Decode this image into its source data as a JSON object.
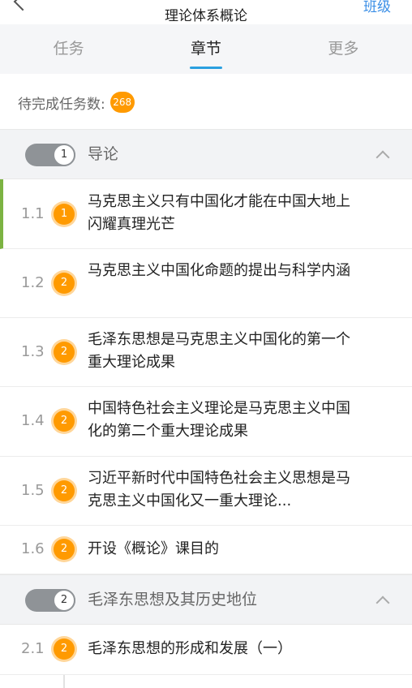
{
  "header": {
    "title": "理论体系概论",
    "right_link": "班级"
  },
  "tabs": [
    {
      "label": "任务"
    },
    {
      "label": "章节"
    },
    {
      "label": "更多"
    }
  ],
  "pending": {
    "label": "待完成任务数:",
    "count": "268"
  },
  "chapters": [
    {
      "number": "1",
      "title": "导论",
      "sections": [
        {
          "number": "1.1",
          "badge": "1",
          "title": "马克思主义只有中国化才能在中国大地上闪耀真理光芒"
        },
        {
          "number": "1.2",
          "badge": "2",
          "title": "马克思主义中国化命题的提出与科学内涵"
        },
        {
          "number": "1.3",
          "badge": "2",
          "title": "毛泽东思想是马克思主义中国化的第一个重大理论成果"
        },
        {
          "number": "1.4",
          "badge": "2",
          "title": "中国特色社会主义理论是马克思主义中国化的第二个重大理论成果"
        },
        {
          "number": "1.5",
          "badge": "2",
          "title": "习近平新时代中国特色社会主义思想是马克思主义中国化又一重大理论..."
        },
        {
          "number": "1.6",
          "badge": "2",
          "title": "开设《概论》课目的"
        }
      ]
    },
    {
      "number": "2",
      "title": "毛泽东思想及其历史地位",
      "sections": [
        {
          "number": "2.1",
          "badge": "2",
          "title": "毛泽东思想的形成和发展（一）"
        }
      ]
    }
  ],
  "colors": {
    "accent": "#2aa0e0",
    "badge": "#ff9a00",
    "current_marker": "#7cb342"
  }
}
